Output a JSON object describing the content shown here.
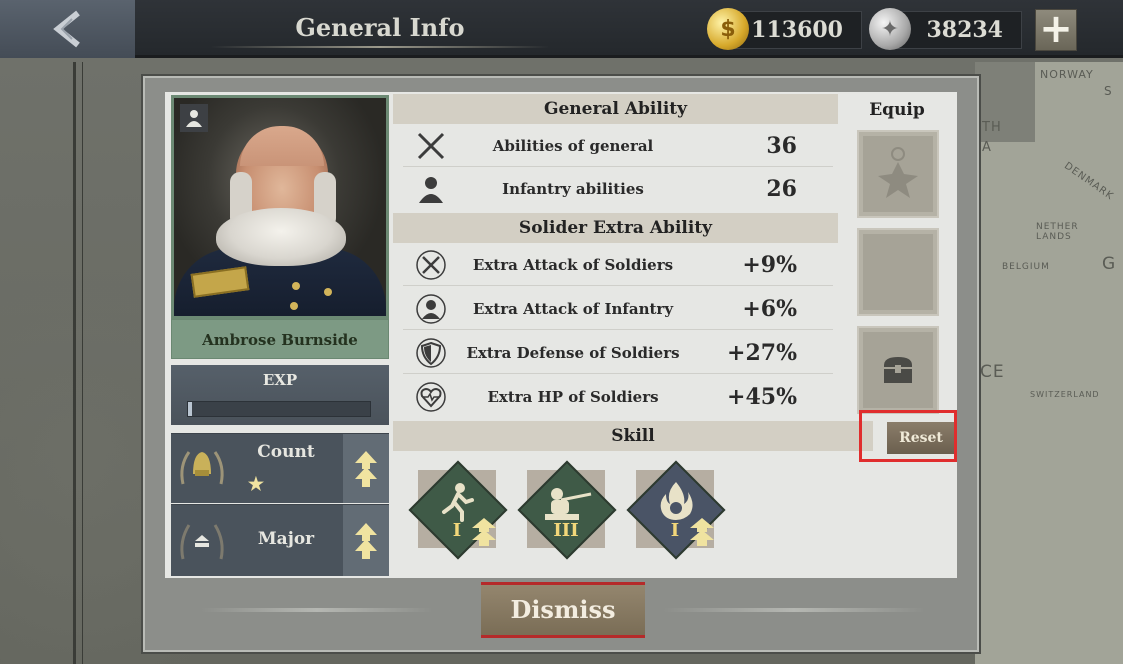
{
  "topbar": {
    "title": "General Info",
    "gold_amount": "113600",
    "silver_amount": "38234",
    "back_icon": "chevron-left-icon",
    "add_icon": "plus-icon"
  },
  "map": {
    "labels": [
      "NORWAY",
      "S",
      "TH",
      "A",
      "DENMARK",
      "NETHER LANDS",
      "BELGIUM",
      "G",
      "CE",
      "SWITZERLAND"
    ]
  },
  "general": {
    "name": "Ambrose Burnside",
    "exp_label": "EXP",
    "exp_progress": 0.01,
    "ranks": [
      {
        "label": "Count",
        "stars": "★"
      },
      {
        "label": "Major",
        "stars": ""
      }
    ]
  },
  "general_ability": {
    "header": "General Ability",
    "rows": [
      {
        "label": "Abilities of general",
        "value": "36",
        "icon": "crossed-swords-icon"
      },
      {
        "label": "Infantry abilities",
        "value": "26",
        "icon": "soldier-icon"
      }
    ]
  },
  "soldier_extra": {
    "header": "Solider Extra Ability",
    "rows": [
      {
        "label": "Extra Attack of Soldiers",
        "value": "+9%",
        "icon": "attack-swords-icon"
      },
      {
        "label": "Extra Attack of Infantry",
        "value": "+6%",
        "icon": "infantry-attack-icon"
      },
      {
        "label": "Extra Defense of Soldiers",
        "value": "+27%",
        "icon": "shield-icon"
      },
      {
        "label": "Extra HP of Soldiers",
        "value": "+45%",
        "icon": "heart-icon"
      }
    ]
  },
  "equip": {
    "header": "Equip",
    "slots": [
      "medal-icon",
      "empty-slot",
      "chest-icon"
    ]
  },
  "skill": {
    "header": "Skill",
    "reset_label": "Reset",
    "items": [
      {
        "level": "I",
        "icon": "running-soldier-icon",
        "color": "#3f5a47"
      },
      {
        "level": "III",
        "icon": "rifleman-icon",
        "color": "#3f5a47"
      },
      {
        "level": "I",
        "icon": "flame-icon",
        "color": "#4a5466"
      }
    ]
  },
  "dismiss_label": "Dismiss",
  "colors": {
    "highlight": "#e02d2d",
    "skill_roman": "#f2d77a"
  }
}
